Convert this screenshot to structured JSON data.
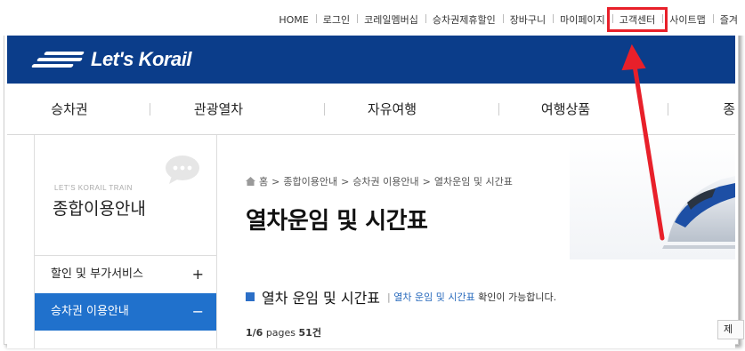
{
  "util_menu": [
    {
      "label": "HOME"
    },
    {
      "label": "로그인"
    },
    {
      "label": "코레일멤버십"
    },
    {
      "label": "승차권제휴할인"
    },
    {
      "label": "장바구니"
    },
    {
      "label": "마이페이지"
    },
    {
      "label": "고객센터",
      "highlighted": true
    },
    {
      "label": "사이트맵"
    },
    {
      "label": "즐겨"
    }
  ],
  "logo": {
    "text": "Let's Korail"
  },
  "nav": [
    {
      "label": "승차권"
    },
    {
      "label": "관광열차"
    },
    {
      "label": "자유여행"
    },
    {
      "label": "여행상품"
    },
    {
      "label": "종"
    }
  ],
  "sidebar": {
    "eng": "LET'S KORAIL TRAIN",
    "title": "종합이용안내",
    "items": [
      {
        "label": "할인 및 부가서비스",
        "sign": "+"
      },
      {
        "label": "승차권 이용안내",
        "sign": "−",
        "active": true
      }
    ]
  },
  "breadcrumb": [
    "홈",
    "종합이용안내",
    "승차권 이용안내",
    "열차운임 및 시간표"
  ],
  "page_title": "열차운임 및 시간표",
  "section": {
    "title": "열차 운임 및 시간표",
    "desc_link": "열차 운임 및 시간표",
    "desc_rest": " 확인이 가능합니다."
  },
  "pages": {
    "current": "1/6",
    "label": " pages ",
    "count": "51건"
  },
  "right_button": "제",
  "colors": {
    "header_blue": "#0b3d8a",
    "active_blue": "#2071cc",
    "highlight_red": "#e8202a"
  }
}
